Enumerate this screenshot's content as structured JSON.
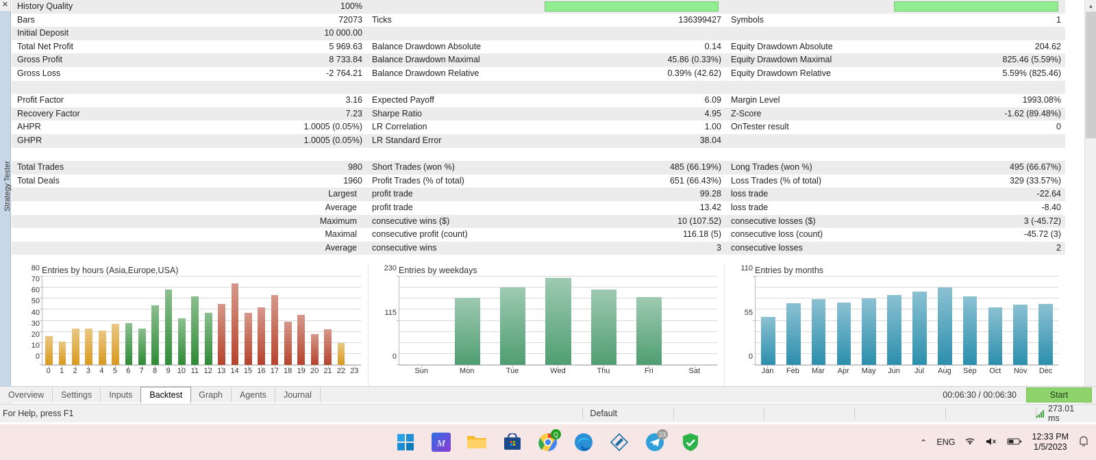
{
  "window": {
    "vertical_tab_label": "Strategy Tester",
    "close_icon": "close-icon"
  },
  "report": {
    "rows": [
      {
        "c1l": "History Quality",
        "c1v": "100%",
        "c2l": "",
        "c2v": "",
        "c3l": "",
        "c3v": "",
        "quality_bar": true
      },
      {
        "c1l": "Bars",
        "c1v": "72073",
        "c2l": "Ticks",
        "c2v": "136399427",
        "c3l": "Symbols",
        "c3v": "1"
      },
      {
        "c1l": "Initial Deposit",
        "c1v": "10 000.00",
        "c2l": "",
        "c2v": "",
        "c3l": "",
        "c3v": ""
      },
      {
        "c1l": "Total Net Profit",
        "c1v": "5 969.63",
        "c2l": "Balance Drawdown Absolute",
        "c2v": "0.14",
        "c3l": "Equity Drawdown Absolute",
        "c3v": "204.62"
      },
      {
        "c1l": "Gross Profit",
        "c1v": "8 733.84",
        "c2l": "Balance Drawdown Maximal",
        "c2v": "45.86 (0.33%)",
        "c3l": "Equity Drawdown Maximal",
        "c3v": "825.46 (5.59%)"
      },
      {
        "c1l": "Gross Loss",
        "c1v": "-2 764.21",
        "c2l": "Balance Drawdown Relative",
        "c2v": "0.39% (42.62)",
        "c3l": "Equity Drawdown Relative",
        "c3v": "5.59% (825.46)"
      },
      {
        "c1l": "",
        "c1v": "",
        "c2l": "",
        "c2v": "",
        "c3l": "",
        "c3v": ""
      },
      {
        "c1l": "Profit Factor",
        "c1v": "3.16",
        "c2l": "Expected Payoff",
        "c2v": "6.09",
        "c3l": "Margin Level",
        "c3v": "1993.08%"
      },
      {
        "c1l": "Recovery Factor",
        "c1v": "7.23",
        "c2l": "Sharpe Ratio",
        "c2v": "4.95",
        "c3l": "Z-Score",
        "c3v": "-1.62 (89.48%)"
      },
      {
        "c1l": "AHPR",
        "c1v": "1.0005 (0.05%)",
        "c2l": "LR Correlation",
        "c2v": "1.00",
        "c3l": "OnTester result",
        "c3v": "0"
      },
      {
        "c1l": "GHPR",
        "c1v": "1.0005 (0.05%)",
        "c2l": "LR Standard Error",
        "c2v": "38.04",
        "c3l": "",
        "c3v": ""
      },
      {
        "c1l": "",
        "c1v": "",
        "c2l": "",
        "c2v": "",
        "c3l": "",
        "c3v": ""
      },
      {
        "c1l": "Total Trades",
        "c1v": "980",
        "c2l": "Short Trades (won %)",
        "c2v": "485 (66.19%)",
        "c3l": "Long Trades (won %)",
        "c3v": "495 (66.67%)"
      },
      {
        "c1l": "Total Deals",
        "c1v": "1960",
        "c2l": "Profit Trades (% of total)",
        "c2v": "651 (66.43%)",
        "c3l": "Loss Trades (% of total)",
        "c3v": "329 (33.57%)"
      },
      {
        "c1l": "Largest",
        "c1v": "",
        "c1align": "right",
        "c2l": "profit trade",
        "c2v": "99.28",
        "c3l": "loss trade",
        "c3v": "-22.64"
      },
      {
        "c1l": "Average",
        "c1v": "",
        "c1align": "right",
        "c2l": "profit trade",
        "c2v": "13.42",
        "c3l": "loss trade",
        "c3v": "-8.40"
      },
      {
        "c1l": "Maximum",
        "c1v": "",
        "c1align": "right",
        "c2l": "consecutive wins ($)",
        "c2v": "10 (107.52)",
        "c3l": "consecutive losses ($)",
        "c3v": "3 (-45.72)"
      },
      {
        "c1l": "Maximal",
        "c1v": "",
        "c1align": "right",
        "c2l": "consecutive profit (count)",
        "c2v": "116.18 (5)",
        "c3l": "consecutive loss (count)",
        "c3v": "-45.72 (3)"
      },
      {
        "c1l": "Average",
        "c1v": "",
        "c1align": "right",
        "c2l": "consecutive wins",
        "c2v": "3",
        "c3l": "consecutive losses",
        "c3v": "2"
      }
    ]
  },
  "chart_data": [
    {
      "type": "bar",
      "title": "Entries by hours (Asia,Europe,USA)",
      "xlabel": "",
      "ylabel": "",
      "ylim": [
        0,
        80
      ],
      "yticks": [
        0,
        10,
        20,
        30,
        40,
        50,
        60,
        70,
        80
      ],
      "grid": true,
      "categories": [
        "0",
        "1",
        "2",
        "3",
        "4",
        "5",
        "6",
        "7",
        "8",
        "9",
        "10",
        "11",
        "12",
        "13",
        "14",
        "15",
        "16",
        "17",
        "18",
        "19",
        "20",
        "21",
        "22",
        "23"
      ],
      "values": [
        26,
        21,
        33,
        33,
        31,
        37,
        38,
        33,
        54,
        68,
        42,
        62,
        47,
        55,
        74,
        47,
        52,
        63,
        39,
        45,
        28,
        32,
        20,
        0
      ],
      "bar_colors": [
        "#d99a1e",
        "#d99a1e",
        "#d99a1e",
        "#d99a1e",
        "#d99a1e",
        "#d99a1e",
        "#2e8b36",
        "#2e8b36",
        "#2e8b36",
        "#2e8b36",
        "#2e8b36",
        "#2e8b36",
        "#2e8b36",
        "#b5432c",
        "#b5432c",
        "#b5432c",
        "#b5432c",
        "#b5432c",
        "#b5432c",
        "#b5432c",
        "#b5432c",
        "#b5432c",
        "#d99a1e",
        "#d99a1e"
      ],
      "legend": [
        "Asia",
        "Europe",
        "USA"
      ]
    },
    {
      "type": "bar",
      "title": "Entries by weekdays",
      "xlabel": "",
      "ylabel": "",
      "ylim": [
        0,
        230
      ],
      "yticks": [
        0,
        115,
        230
      ],
      "grid": true,
      "categories": [
        "Sun",
        "Mon",
        "Tue",
        "Wed",
        "Thu",
        "Fri",
        "Sat"
      ],
      "values": [
        0,
        175,
        201,
        227,
        196,
        176,
        0
      ],
      "bar_color": "#4f9e72"
    },
    {
      "type": "bar",
      "title": "Entries by months",
      "xlabel": "",
      "ylabel": "",
      "ylim": [
        0,
        110
      ],
      "yticks": [
        0,
        55,
        110
      ],
      "grid": true,
      "categories": [
        "Jan",
        "Feb",
        "Mar",
        "Apr",
        "May",
        "Jun",
        "Jul",
        "Aug",
        "Sep",
        "Oct",
        "Nov",
        "Dec"
      ],
      "values": [
        60,
        77,
        82,
        78,
        83,
        87,
        91,
        96,
        85,
        72,
        75,
        76
      ],
      "bar_color": "#2c8fad"
    }
  ],
  "tabs": [
    {
      "label": "Overview",
      "active": false
    },
    {
      "label": "Settings",
      "active": false
    },
    {
      "label": "Inputs",
      "active": false
    },
    {
      "label": "Backtest",
      "active": true
    },
    {
      "label": "Graph",
      "active": false
    },
    {
      "label": "Agents",
      "active": false
    },
    {
      "label": "Journal",
      "active": false
    }
  ],
  "footer": {
    "elapsed": "00:06:30 / 00:06:30",
    "start_label": "Start",
    "start_color": "#8ed36b"
  },
  "statusbar": {
    "help": "For Help, press F1",
    "profile": "Default",
    "ping": "273.01 ms"
  },
  "taskbar": {
    "icons": [
      {
        "name": "start-windows-icon",
        "glyph": ""
      },
      {
        "name": "metatrader-icon",
        "glyph": "M"
      },
      {
        "name": "file-explorer-icon",
        "glyph": ""
      },
      {
        "name": "microsoft-store-icon",
        "glyph": ""
      },
      {
        "name": "google-chrome-icon",
        "glyph": "",
        "badge": "Q"
      },
      {
        "name": "microsoft-edge-icon",
        "glyph": ""
      },
      {
        "name": "editor-icon",
        "glyph": ""
      },
      {
        "name": "telegram-icon",
        "glyph": "",
        "badge": "23"
      },
      {
        "name": "security-icon",
        "glyph": "✓"
      }
    ],
    "tray": {
      "chevron": "⌃",
      "language": "ENG",
      "wifi_icon": "wifi-icon",
      "volume_icon": "volume-icon",
      "battery_icon": "battery-icon",
      "time": "12:33 PM",
      "date": "1/5/2023",
      "notification_icon": "notifications-icon"
    }
  }
}
